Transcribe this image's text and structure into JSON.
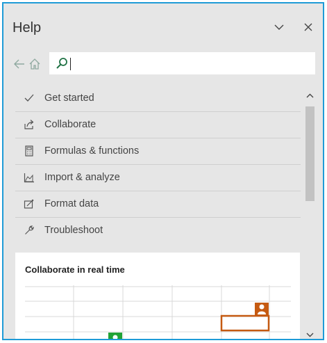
{
  "pane": {
    "title": "Help",
    "collapse_icon": "chevron-down-icon",
    "close_icon": "close-icon"
  },
  "search": {
    "value": "",
    "back_icon": "arrow-left-icon",
    "home_icon": "home-icon",
    "search_icon": "search-icon"
  },
  "menu": {
    "items": [
      {
        "label": "Get started",
        "icon": "checkmark-icon"
      },
      {
        "label": "Collaborate",
        "icon": "share-icon"
      },
      {
        "label": "Formulas & functions",
        "icon": "calculator-icon"
      },
      {
        "label": "Import & analyze",
        "icon": "chart-icon"
      },
      {
        "label": "Format data",
        "icon": "format-icon"
      },
      {
        "label": "Troubleshoot",
        "icon": "wrench-icon"
      }
    ]
  },
  "card": {
    "title": "Collaborate in real time",
    "illustration": {
      "accent_orange": "#c55a11",
      "accent_green": "#21a336",
      "gridline_color": "#d9d9d9"
    }
  },
  "colors": {
    "pane_bg": "#e6e6e6",
    "border": "#1e9bd7",
    "search_icon": "#217346"
  }
}
